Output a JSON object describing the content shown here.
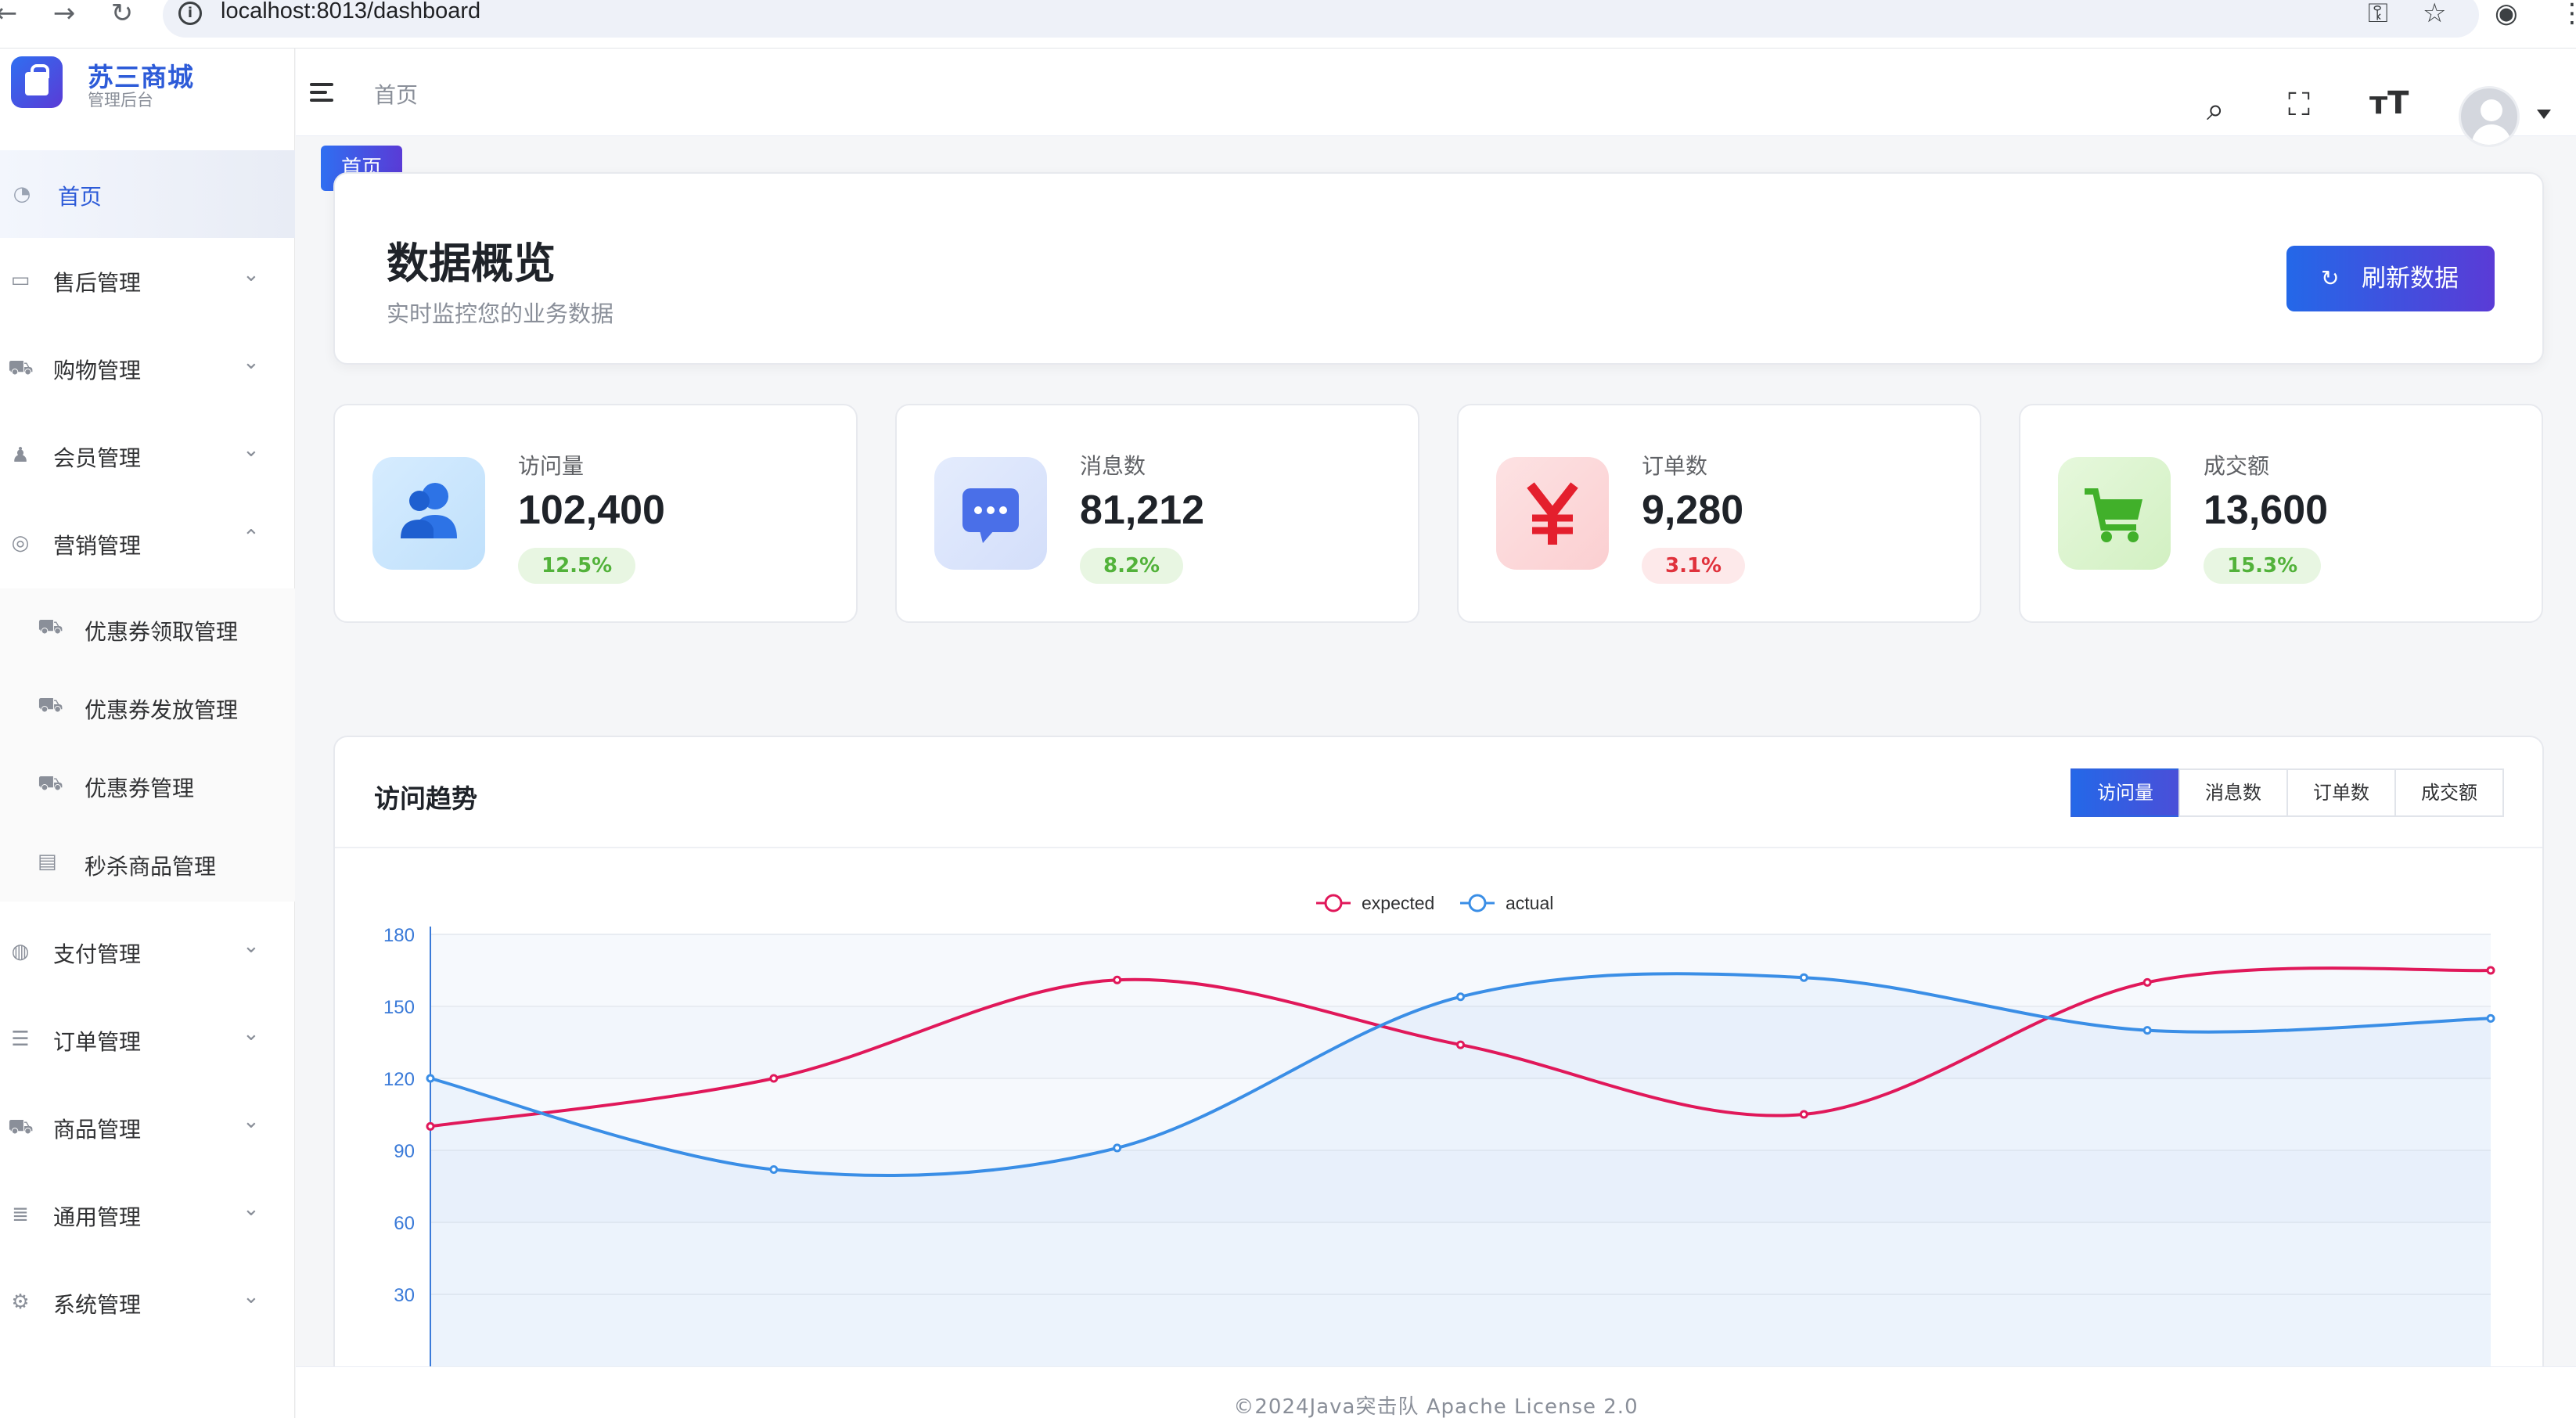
{
  "browser": {
    "url": "localhost:8013/dashboard"
  },
  "sidebar": {
    "brand_name": "苏三商城",
    "brand_sub": "管理后台",
    "items": [
      {
        "label": "首页",
        "icon": "dashboard-icon"
      },
      {
        "label": "售后管理",
        "icon": "chat-icon"
      },
      {
        "label": "购物管理",
        "icon": "cart-icon"
      },
      {
        "label": "会员管理",
        "icon": "user-icon"
      },
      {
        "label": "营销管理",
        "icon": "marketing-icon"
      },
      {
        "label": "支付管理",
        "icon": "payment-icon"
      },
      {
        "label": "订单管理",
        "icon": "list-icon"
      },
      {
        "label": "商品管理",
        "icon": "cart-icon"
      },
      {
        "label": "通用管理",
        "icon": "database-icon"
      },
      {
        "label": "系统管理",
        "icon": "gear-icon"
      }
    ],
    "submenu": [
      {
        "label": "优惠券领取管理",
        "icon": "cart-icon"
      },
      {
        "label": "优惠券发放管理",
        "icon": "cart-icon"
      },
      {
        "label": "优惠券管理",
        "icon": "cart-icon"
      },
      {
        "label": "秒杀商品管理",
        "icon": "flash-sale-icon"
      }
    ]
  },
  "header": {
    "breadcrumb": "首页",
    "tab_home": "首页"
  },
  "overview": {
    "title": "数据概览",
    "subtitle": "实时监控您的业务数据",
    "refresh_label": "刷新数据"
  },
  "stats": [
    {
      "label": "访问量",
      "value": "102,400",
      "change": "12.5%",
      "trend": "up"
    },
    {
      "label": "消息数",
      "value": "81,212",
      "change": "8.2%",
      "trend": "up"
    },
    {
      "label": "订单数",
      "value": "9,280",
      "change": "3.1%",
      "trend": "down"
    },
    {
      "label": "成交额",
      "value": "13,600",
      "change": "15.3%",
      "trend": "up"
    }
  ],
  "trend": {
    "title": "访问趋势",
    "tabs": [
      "访问量",
      "消息数",
      "订单数",
      "成交额"
    ],
    "active_tab": 0
  },
  "chart_data": {
    "type": "line",
    "x": [
      0,
      1,
      2,
      3,
      4,
      5,
      6
    ],
    "ylim": [
      0,
      180
    ],
    "yticks": [
      30,
      60,
      90,
      120,
      150,
      180
    ],
    "series": [
      {
        "name": "expected",
        "color": "#e0185a",
        "values": [
          100,
          120,
          161,
          134,
          105,
          160,
          165
        ]
      },
      {
        "name": "actual",
        "color": "#3a8ee6",
        "values": [
          120,
          82,
          91,
          154,
          162,
          140,
          145
        ]
      }
    ],
    "legend": "top-center",
    "grid": true
  },
  "footer": {
    "text": "©2024Java突击队 Apache License 2.0"
  }
}
